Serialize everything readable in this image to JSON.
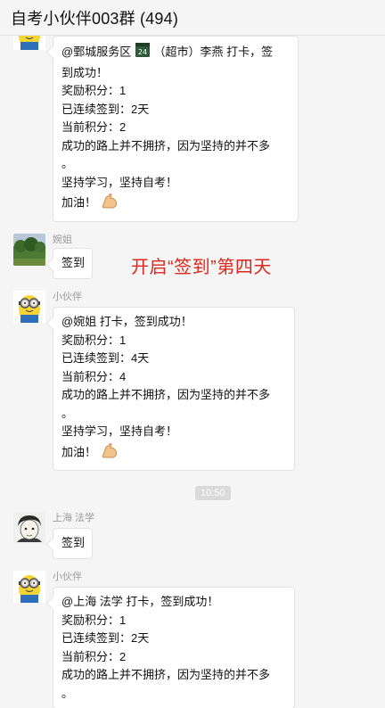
{
  "window": {
    "title": "自考小伙伴003群 (494)"
  },
  "colors": {
    "background": "#f5f5f5",
    "bubble": "#ffffff",
    "annotation": "#e0261b",
    "sender_name": "#9a9a9a"
  },
  "messages": [
    {
      "sender": "",
      "avatar": "minion-avatar",
      "lines": [
        "@鄄城服务区",
        "（超市）李燕 打卡，签",
        "到成功！",
        "奖励积分：1",
        "已连续签到：2天",
        "当前积分：2",
        "成功的路上并不拥挤，因为坚持的并不多",
        "。",
        "坚持学习，坚持自考！",
        "加油！"
      ],
      "inline_badge": "24"
    },
    {
      "sender": "婉姐",
      "avatar": "landscape-photo-avatar",
      "lines": [
        "签到"
      ]
    },
    {
      "sender": "小伙伴",
      "avatar": "minion-avatar",
      "lines": [
        "@婉姐 打卡，签到成功！",
        "奖励积分：1",
        "已连续签到：4天",
        "当前积分：4",
        "成功的路上并不拥挤，因为坚持的并不多",
        "。",
        "坚持学习，坚持自考！",
        "加油！"
      ]
    },
    {
      "sender": "上海 法学",
      "avatar": "sketch-face-avatar",
      "lines": [
        "签到"
      ]
    },
    {
      "sender": "小伙伴",
      "avatar": "minion-avatar",
      "lines": [
        "@上海 法学 打卡，签到成功！",
        "奖励积分：1",
        "已连续签到：2天",
        "当前积分：2",
        "成功的路上并不拥挤，因为坚持的并不多",
        "。"
      ]
    }
  ],
  "timestamp": "10:50",
  "annotation": "开启“签到”第四天"
}
